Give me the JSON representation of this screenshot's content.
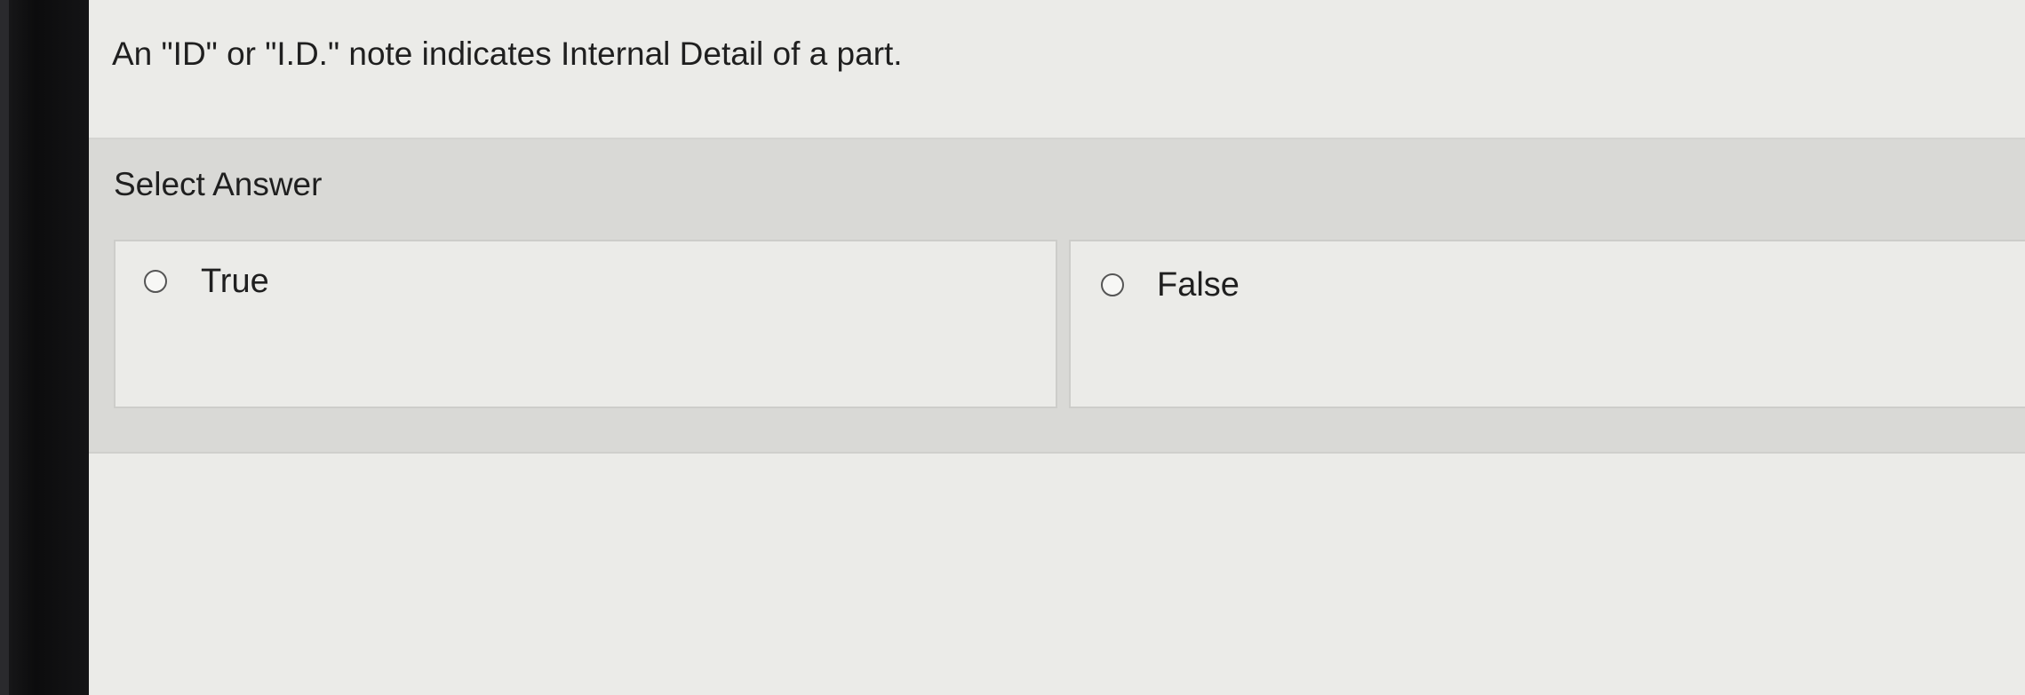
{
  "question": {
    "text": "An \"ID\" or \"I.D.\" note indicates Internal Detail of a part."
  },
  "answer": {
    "select_label": "Select Answer",
    "options": [
      {
        "label": "True",
        "selected": false
      },
      {
        "label": "False",
        "selected": false
      }
    ]
  },
  "colors": {
    "background": "#ebebe8",
    "answer_panel": "#d9d9d6",
    "bezel": "#111113"
  }
}
